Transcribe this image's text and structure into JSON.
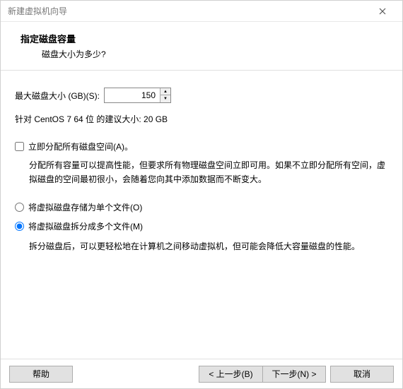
{
  "window": {
    "title": "新建虚拟机向导"
  },
  "header": {
    "title": "指定磁盘容量",
    "subtitle": "磁盘大小为多少?"
  },
  "disk": {
    "label": "最大磁盘大小 (GB)(S):",
    "value": "150",
    "recommend": "针对 CentOS 7 64 位 的建议大小: 20 GB"
  },
  "allocate": {
    "label": "立即分配所有磁盘空间(A)。",
    "desc": "分配所有容量可以提高性能，但要求所有物理磁盘空间立即可用。如果不立即分配所有空间，虚拟磁盘的空间最初很小，会随着您向其中添加数据而不断变大。"
  },
  "store": {
    "single": "将虚拟磁盘存储为单个文件(O)",
    "split": "将虚拟磁盘拆分成多个文件(M)",
    "split_desc": "拆分磁盘后，可以更轻松地在计算机之间移动虚拟机，但可能会降低大容量磁盘的性能。"
  },
  "buttons": {
    "help": "帮助",
    "back": "< 上一步(B)",
    "next": "下一步(N) >",
    "cancel": "取消"
  }
}
